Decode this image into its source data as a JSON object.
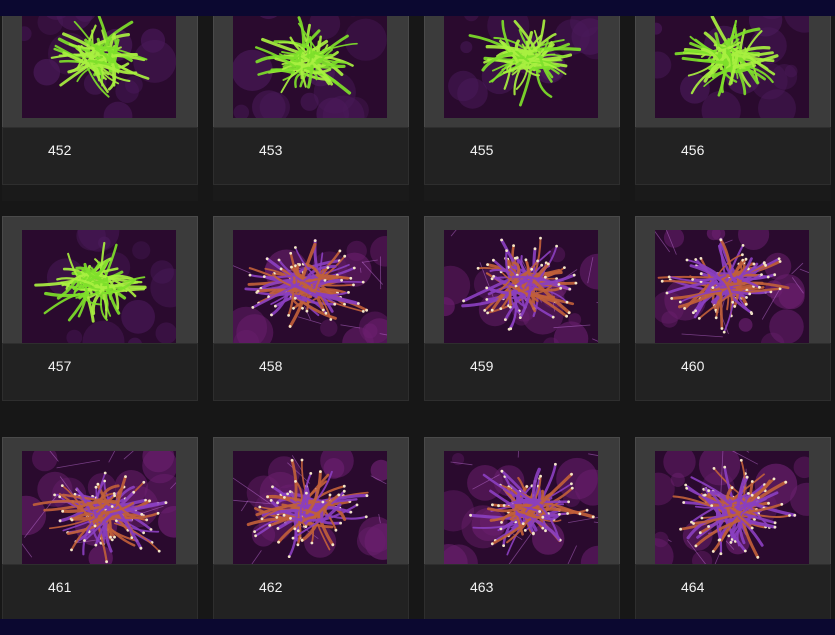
{
  "gallery": {
    "items": [
      {
        "label": "452",
        "variant": "green"
      },
      {
        "label": "453",
        "variant": "green"
      },
      {
        "label": "455",
        "variant": "green"
      },
      {
        "label": "456",
        "variant": "green"
      },
      {
        "label": "457",
        "variant": "green"
      },
      {
        "label": "458",
        "variant": "purple"
      },
      {
        "label": "459",
        "variant": "purple"
      },
      {
        "label": "460",
        "variant": "purple"
      },
      {
        "label": "461",
        "variant": "purple"
      },
      {
        "label": "462",
        "variant": "purple"
      },
      {
        "label": "463",
        "variant": "purple"
      },
      {
        "label": "464",
        "variant": "purple"
      }
    ]
  },
  "colors": {
    "page_background": "#171717",
    "frame": "#3b3b3b",
    "caption_background": "#222222",
    "caption_text": "#f2f2f2",
    "green_coral": "#7ee02a",
    "purple_coral": "#8a3fbf",
    "tank_background": "#2a0a2e"
  }
}
